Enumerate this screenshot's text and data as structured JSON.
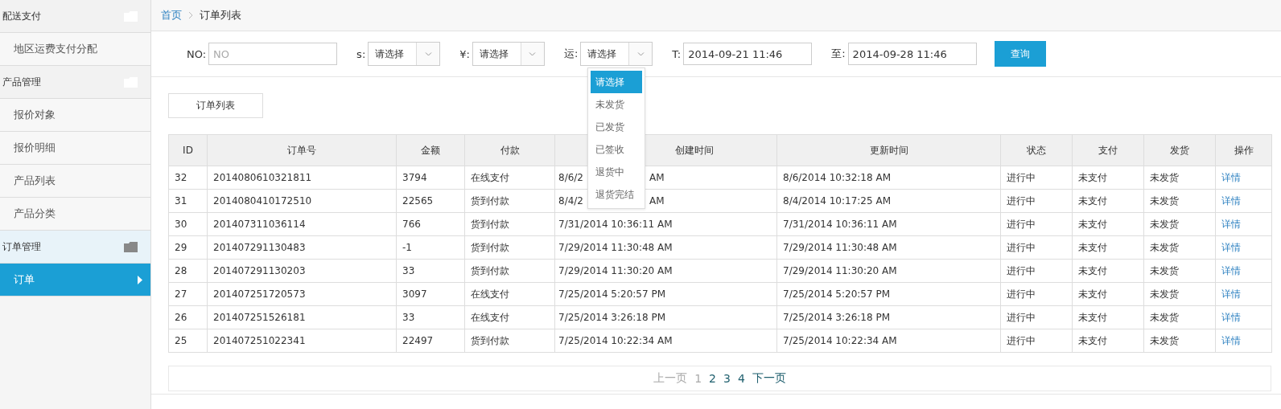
{
  "sidebar": {
    "groups": [
      {
        "label": "配送支付",
        "active": false,
        "items": [
          {
            "label": "地区运费支付分配",
            "selected": false
          }
        ]
      },
      {
        "label": "产品管理",
        "active": false,
        "items": [
          {
            "label": "报价对象",
            "selected": false
          },
          {
            "label": "报价明细",
            "selected": false
          },
          {
            "label": "产品列表",
            "selected": false
          },
          {
            "label": "产品分类",
            "selected": false
          }
        ]
      },
      {
        "label": "订单管理",
        "active": true,
        "items": [
          {
            "label": "订单",
            "selected": true
          }
        ]
      }
    ]
  },
  "breadcrumb": [
    {
      "label": "首页",
      "link": true
    },
    {
      "label": "订单列表",
      "link": false
    }
  ],
  "filters": [
    {
      "kind": "text",
      "label": "NO:",
      "placeholder": "NO"
    },
    {
      "kind": "select",
      "label": "s:",
      "value": "请选择"
    },
    {
      "kind": "select",
      "label": "¥:",
      "value": "请选择"
    },
    {
      "kind": "select",
      "label": "运:",
      "value": "请选择",
      "options": [
        {
          "label": "请选择",
          "selected": true
        },
        {
          "label": "未发货",
          "selected": false
        },
        {
          "label": "已发货",
          "selected": false
        },
        {
          "label": "已签收",
          "selected": false
        },
        {
          "label": "退货中",
          "selected": false
        },
        {
          "label": "退货完结",
          "selected": false
        }
      ]
    },
    {
      "kind": "text",
      "label": "T:",
      "value": "2014-09-21 11:46"
    },
    {
      "kind": "text",
      "label": "至:",
      "value": "2014-09-28 11:46"
    }
  ],
  "search_button": "查询",
  "panel_tab": "订单列表",
  "table": {
    "columns": [
      "ID",
      "订单号",
      "金额",
      "付款",
      "创建时间",
      "更新时间",
      "状态",
      "支付",
      "发货",
      "操作"
    ],
    "rows": [
      {
        "id": "32",
        "order_no": "2014080610321811",
        "amount": "3794",
        "payment": "在线支付",
        "created": "8/6/2",
        "created_tail": "AM",
        "updated": "8/6/2014 10:32:18 AM",
        "status": "进行中",
        "pay": "未支付",
        "ship": "未发货",
        "action": "详情"
      },
      {
        "id": "31",
        "order_no": "2014080410172510",
        "amount": "22565",
        "payment": "货到付款",
        "created": "8/4/2",
        "created_tail": "AM",
        "updated": "8/4/2014 10:17:25 AM",
        "status": "进行中",
        "pay": "未支付",
        "ship": "未发货",
        "action": "详情"
      },
      {
        "id": "30",
        "order_no": "201407311036114",
        "amount": "766",
        "payment": "货到付款",
        "created": "7/31/2014 10:36:11 AM",
        "updated": "7/31/2014 10:36:11 AM",
        "status": "进行中",
        "pay": "未支付",
        "ship": "未发货",
        "action": "详情"
      },
      {
        "id": "29",
        "order_no": "201407291130483",
        "amount": "-1",
        "payment": "货到付款",
        "created": "7/29/2014 11:30:48 AM",
        "updated": "7/29/2014 11:30:48 AM",
        "status": "进行中",
        "pay": "未支付",
        "ship": "未发货",
        "action": "详情"
      },
      {
        "id": "28",
        "order_no": "201407291130203",
        "amount": "33",
        "payment": "货到付款",
        "created": "7/29/2014 11:30:20 AM",
        "updated": "7/29/2014 11:30:20 AM",
        "status": "进行中",
        "pay": "未支付",
        "ship": "未发货",
        "action": "详情"
      },
      {
        "id": "27",
        "order_no": "201407251720573",
        "amount": "3097",
        "payment": "在线支付",
        "created": "7/25/2014 5:20:57 PM",
        "updated": "7/25/2014 5:20:57 PM",
        "status": "进行中",
        "pay": "未支付",
        "ship": "未发货",
        "action": "详情"
      },
      {
        "id": "26",
        "order_no": "201407251526181",
        "amount": "33",
        "payment": "在线支付",
        "created": "7/25/2014 3:26:18 PM",
        "updated": "7/25/2014 3:26:18 PM",
        "status": "进行中",
        "pay": "未支付",
        "ship": "未发货",
        "action": "详情"
      },
      {
        "id": "25",
        "order_no": "201407251022341",
        "amount": "22497",
        "payment": "货到付款",
        "created": "7/25/2014 10:22:34 AM",
        "updated": "7/25/2014 10:22:34 AM",
        "status": "进行中",
        "pay": "未支付",
        "ship": "未发货",
        "action": "详情"
      }
    ]
  },
  "pagination": {
    "prev": {
      "label": "上一页",
      "disabled": true
    },
    "pages": [
      {
        "label": "1",
        "selected": true
      },
      {
        "label": "2",
        "selected": false
      },
      {
        "label": "3",
        "selected": false
      },
      {
        "label": "4",
        "selected": false
      }
    ],
    "next": {
      "label": "下一页",
      "disabled": false
    }
  }
}
